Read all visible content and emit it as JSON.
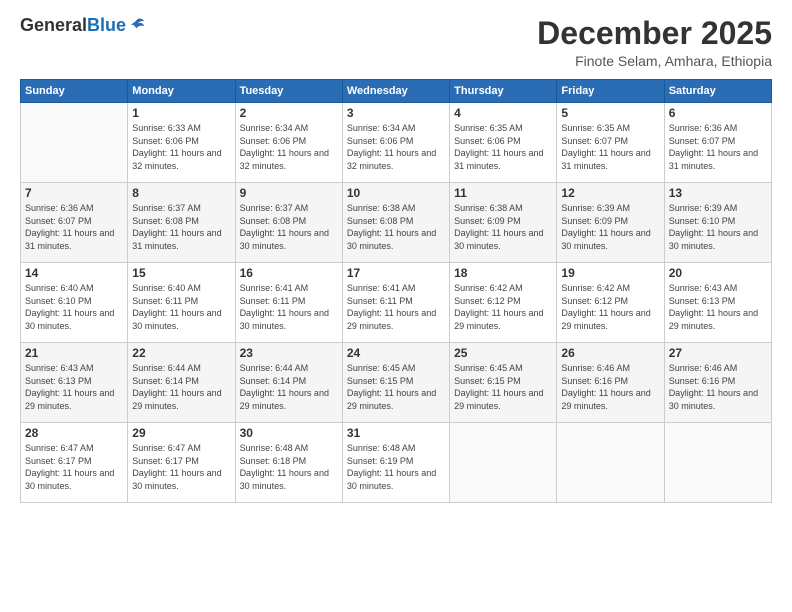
{
  "header": {
    "logo_general": "General",
    "logo_blue": "Blue",
    "month": "December 2025",
    "location": "Finote Selam, Amhara, Ethiopia"
  },
  "weekdays": [
    "Sunday",
    "Monday",
    "Tuesday",
    "Wednesday",
    "Thursday",
    "Friday",
    "Saturday"
  ],
  "weeks": [
    [
      {
        "day": "",
        "sunrise": "",
        "sunset": "",
        "daylight": ""
      },
      {
        "day": "1",
        "sunrise": "Sunrise: 6:33 AM",
        "sunset": "Sunset: 6:06 PM",
        "daylight": "Daylight: 11 hours and 32 minutes."
      },
      {
        "day": "2",
        "sunrise": "Sunrise: 6:34 AM",
        "sunset": "Sunset: 6:06 PM",
        "daylight": "Daylight: 11 hours and 32 minutes."
      },
      {
        "day": "3",
        "sunrise": "Sunrise: 6:34 AM",
        "sunset": "Sunset: 6:06 PM",
        "daylight": "Daylight: 11 hours and 32 minutes."
      },
      {
        "day": "4",
        "sunrise": "Sunrise: 6:35 AM",
        "sunset": "Sunset: 6:06 PM",
        "daylight": "Daylight: 11 hours and 31 minutes."
      },
      {
        "day": "5",
        "sunrise": "Sunrise: 6:35 AM",
        "sunset": "Sunset: 6:07 PM",
        "daylight": "Daylight: 11 hours and 31 minutes."
      },
      {
        "day": "6",
        "sunrise": "Sunrise: 6:36 AM",
        "sunset": "Sunset: 6:07 PM",
        "daylight": "Daylight: 11 hours and 31 minutes."
      }
    ],
    [
      {
        "day": "7",
        "sunrise": "Sunrise: 6:36 AM",
        "sunset": "Sunset: 6:07 PM",
        "daylight": "Daylight: 11 hours and 31 minutes."
      },
      {
        "day": "8",
        "sunrise": "Sunrise: 6:37 AM",
        "sunset": "Sunset: 6:08 PM",
        "daylight": "Daylight: 11 hours and 31 minutes."
      },
      {
        "day": "9",
        "sunrise": "Sunrise: 6:37 AM",
        "sunset": "Sunset: 6:08 PM",
        "daylight": "Daylight: 11 hours and 30 minutes."
      },
      {
        "day": "10",
        "sunrise": "Sunrise: 6:38 AM",
        "sunset": "Sunset: 6:08 PM",
        "daylight": "Daylight: 11 hours and 30 minutes."
      },
      {
        "day": "11",
        "sunrise": "Sunrise: 6:38 AM",
        "sunset": "Sunset: 6:09 PM",
        "daylight": "Daylight: 11 hours and 30 minutes."
      },
      {
        "day": "12",
        "sunrise": "Sunrise: 6:39 AM",
        "sunset": "Sunset: 6:09 PM",
        "daylight": "Daylight: 11 hours and 30 minutes."
      },
      {
        "day": "13",
        "sunrise": "Sunrise: 6:39 AM",
        "sunset": "Sunset: 6:10 PM",
        "daylight": "Daylight: 11 hours and 30 minutes."
      }
    ],
    [
      {
        "day": "14",
        "sunrise": "Sunrise: 6:40 AM",
        "sunset": "Sunset: 6:10 PM",
        "daylight": "Daylight: 11 hours and 30 minutes."
      },
      {
        "day": "15",
        "sunrise": "Sunrise: 6:40 AM",
        "sunset": "Sunset: 6:11 PM",
        "daylight": "Daylight: 11 hours and 30 minutes."
      },
      {
        "day": "16",
        "sunrise": "Sunrise: 6:41 AM",
        "sunset": "Sunset: 6:11 PM",
        "daylight": "Daylight: 11 hours and 30 minutes."
      },
      {
        "day": "17",
        "sunrise": "Sunrise: 6:41 AM",
        "sunset": "Sunset: 6:11 PM",
        "daylight": "Daylight: 11 hours and 29 minutes."
      },
      {
        "day": "18",
        "sunrise": "Sunrise: 6:42 AM",
        "sunset": "Sunset: 6:12 PM",
        "daylight": "Daylight: 11 hours and 29 minutes."
      },
      {
        "day": "19",
        "sunrise": "Sunrise: 6:42 AM",
        "sunset": "Sunset: 6:12 PM",
        "daylight": "Daylight: 11 hours and 29 minutes."
      },
      {
        "day": "20",
        "sunrise": "Sunrise: 6:43 AM",
        "sunset": "Sunset: 6:13 PM",
        "daylight": "Daylight: 11 hours and 29 minutes."
      }
    ],
    [
      {
        "day": "21",
        "sunrise": "Sunrise: 6:43 AM",
        "sunset": "Sunset: 6:13 PM",
        "daylight": "Daylight: 11 hours and 29 minutes."
      },
      {
        "day": "22",
        "sunrise": "Sunrise: 6:44 AM",
        "sunset": "Sunset: 6:14 PM",
        "daylight": "Daylight: 11 hours and 29 minutes."
      },
      {
        "day": "23",
        "sunrise": "Sunrise: 6:44 AM",
        "sunset": "Sunset: 6:14 PM",
        "daylight": "Daylight: 11 hours and 29 minutes."
      },
      {
        "day": "24",
        "sunrise": "Sunrise: 6:45 AM",
        "sunset": "Sunset: 6:15 PM",
        "daylight": "Daylight: 11 hours and 29 minutes."
      },
      {
        "day": "25",
        "sunrise": "Sunrise: 6:45 AM",
        "sunset": "Sunset: 6:15 PM",
        "daylight": "Daylight: 11 hours and 29 minutes."
      },
      {
        "day": "26",
        "sunrise": "Sunrise: 6:46 AM",
        "sunset": "Sunset: 6:16 PM",
        "daylight": "Daylight: 11 hours and 29 minutes."
      },
      {
        "day": "27",
        "sunrise": "Sunrise: 6:46 AM",
        "sunset": "Sunset: 6:16 PM",
        "daylight": "Daylight: 11 hours and 30 minutes."
      }
    ],
    [
      {
        "day": "28",
        "sunrise": "Sunrise: 6:47 AM",
        "sunset": "Sunset: 6:17 PM",
        "daylight": "Daylight: 11 hours and 30 minutes."
      },
      {
        "day": "29",
        "sunrise": "Sunrise: 6:47 AM",
        "sunset": "Sunset: 6:17 PM",
        "daylight": "Daylight: 11 hours and 30 minutes."
      },
      {
        "day": "30",
        "sunrise": "Sunrise: 6:48 AM",
        "sunset": "Sunset: 6:18 PM",
        "daylight": "Daylight: 11 hours and 30 minutes."
      },
      {
        "day": "31",
        "sunrise": "Sunrise: 6:48 AM",
        "sunset": "Sunset: 6:19 PM",
        "daylight": "Daylight: 11 hours and 30 minutes."
      },
      {
        "day": "",
        "sunrise": "",
        "sunset": "",
        "daylight": ""
      },
      {
        "day": "",
        "sunrise": "",
        "sunset": "",
        "daylight": ""
      },
      {
        "day": "",
        "sunrise": "",
        "sunset": "",
        "daylight": ""
      }
    ]
  ]
}
